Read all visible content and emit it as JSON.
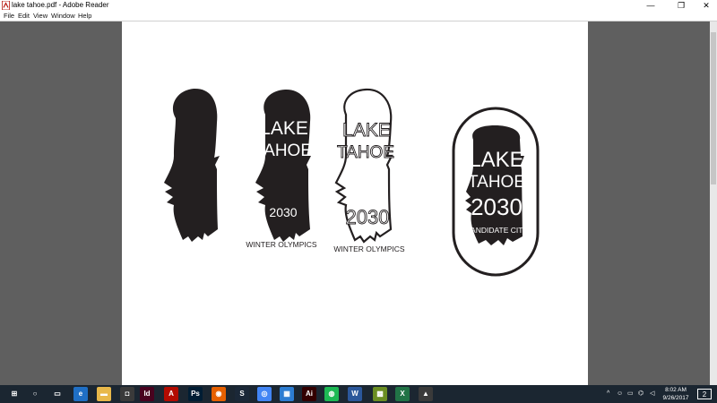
{
  "window": {
    "title": "lake tahoe.pdf - Adobe Reader",
    "minimize_glyph": "—",
    "maximize_glyph": "❐",
    "close_glyph": "✕"
  },
  "menu": {
    "file": "File",
    "edit": "Edit",
    "view": "View",
    "window": "Window",
    "help": "Help"
  },
  "document": {
    "logo2": {
      "line1": "LAKE",
      "line2": "TAHOE",
      "year": "2030",
      "caption": "WINTER OLYMPICS"
    },
    "logo3": {
      "line1": "LAKE",
      "line2": "TAHOE",
      "year": "2030",
      "caption": "WINTER OLYMPICS"
    },
    "logo4": {
      "line1": "LAKE",
      "line2": "TAHOE",
      "year": "2030",
      "caption": "CANDIDATE CITY"
    }
  },
  "taskbar": {
    "apps": [
      {
        "name": "start-button",
        "glyph": "⊞",
        "color": "#1b2631"
      },
      {
        "name": "cortana-search",
        "glyph": "○",
        "color": "#1b2631"
      },
      {
        "name": "task-view",
        "glyph": "▭",
        "color": "#1b2631"
      },
      {
        "name": "edge",
        "glyph": "e",
        "color": "#1f6fc5"
      },
      {
        "name": "file-explorer",
        "glyph": "▬",
        "color": "#e8b84a"
      },
      {
        "name": "store",
        "glyph": "◘",
        "color": "#3a3a3a"
      },
      {
        "name": "indesign",
        "glyph": "Id",
        "color": "#49021f"
      },
      {
        "name": "adobe-reader",
        "glyph": "A",
        "color": "#b30b00"
      },
      {
        "name": "photoshop",
        "glyph": "Ps",
        "color": "#001d34"
      },
      {
        "name": "firefox",
        "glyph": "◉",
        "color": "#e66000"
      },
      {
        "name": "steam",
        "glyph": "S",
        "color": "#1b2838"
      },
      {
        "name": "chrome",
        "glyph": "◎",
        "color": "#4285f4"
      },
      {
        "name": "calculator",
        "glyph": "▦",
        "color": "#2d7dd2"
      },
      {
        "name": "illustrator",
        "glyph": "Ai",
        "color": "#330000"
      },
      {
        "name": "spotify",
        "glyph": "◍",
        "color": "#1db954"
      },
      {
        "name": "word",
        "glyph": "W",
        "color": "#2b579a"
      },
      {
        "name": "minecraft",
        "glyph": "▩",
        "color": "#6b8e23"
      },
      {
        "name": "excel",
        "glyph": "X",
        "color": "#217346"
      },
      {
        "name": "photos",
        "glyph": "▲",
        "color": "#3a3a3a"
      }
    ],
    "time": "8:02 AM",
    "date": "9/26/2017",
    "notification_count": "2"
  }
}
